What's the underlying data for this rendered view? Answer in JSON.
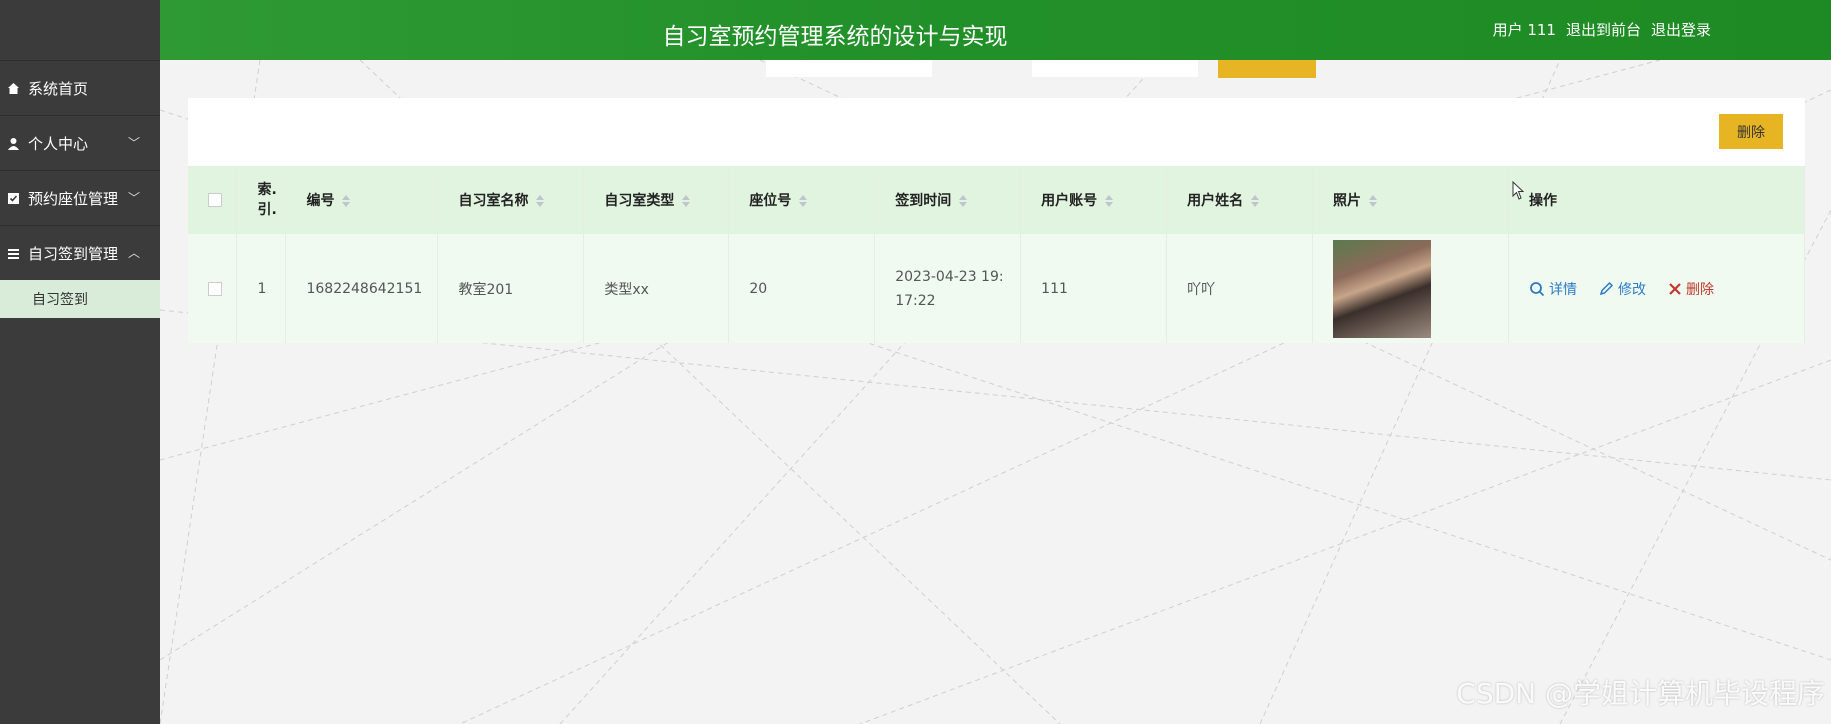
{
  "header": {
    "title": "自习室预约管理系统的设计与实现",
    "user_label": "用户 111",
    "back_link": "退出到前台",
    "logout_link": "退出登录"
  },
  "sidebar": {
    "items": [
      {
        "label": "系统首页",
        "icon": "home-icon"
      },
      {
        "label": "个人中心",
        "icon": "user-icon"
      },
      {
        "label": "预约座位管理",
        "icon": "checkbox-icon"
      },
      {
        "label": "自习签到管理",
        "icon": "list-icon"
      }
    ],
    "sub_item": "自习签到"
  },
  "toolbar": {
    "delete_label": "删除"
  },
  "table": {
    "headers": {
      "index": "索引",
      "index_a": "索.",
      "index_b": "引.",
      "number": "编号",
      "room_name": "自习室名称",
      "room_type": "自习室类型",
      "seat": "座位号",
      "checkin_time": "签到时间",
      "account": "用户账号",
      "user_name": "用户姓名",
      "photo": "照片",
      "actions": "操作"
    },
    "rows": [
      {
        "index": "1",
        "number": "1682248642151",
        "room_name": "教室201",
        "room_type": "类型xx",
        "seat": "20",
        "checkin_time_a": "2023-04-23 19:",
        "checkin_time_b": "17:22",
        "account": "111",
        "user_name": "吖吖"
      }
    ],
    "actions": {
      "detail": "详情",
      "edit": "修改",
      "delete": "删除"
    }
  },
  "watermark": "CSDN @学姐计算机毕设程序",
  "colors": {
    "header_green": "#23912a",
    "sidebar_dark": "#3b3b3b",
    "accent_yellow": "#e7b524",
    "table_head": "#e0f4e0"
  }
}
